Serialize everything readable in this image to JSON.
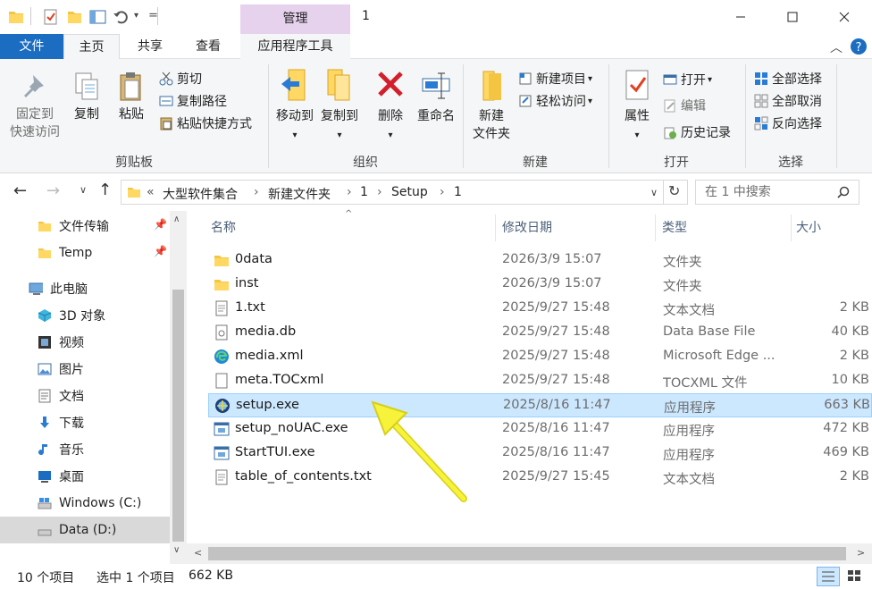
{
  "window": {
    "title": "1",
    "context_tab": "管理"
  },
  "tabs": {
    "file": "文件",
    "home": "主页",
    "share": "共享",
    "view": "查看",
    "app_tools": "应用程序工具"
  },
  "ribbon": {
    "clipboard": {
      "pin": "固定到\n快速访问",
      "pin_l1": "固定到",
      "pin_l2": "快速访问",
      "copy": "复制",
      "paste": "粘贴",
      "cut": "剪切",
      "copy_path": "复制路径",
      "paste_shortcut": "粘贴快捷方式",
      "label": "剪贴板"
    },
    "organize": {
      "move_to": "移动到",
      "copy_to": "复制到",
      "delete": "删除",
      "rename": "重命名",
      "label": "组织"
    },
    "new": {
      "new_folder_l1": "新建",
      "new_folder_l2": "文件夹",
      "new_item": "新建项目",
      "easy_access": "轻松访问",
      "label": "新建"
    },
    "open": {
      "properties": "属性",
      "open": "打开",
      "edit": "编辑",
      "history": "历史记录",
      "label": "打开"
    },
    "select": {
      "select_all": "全部选择",
      "select_none": "全部取消",
      "invert": "反向选择",
      "label": "选择"
    }
  },
  "address": {
    "prefix": "«",
    "crumbs": [
      "大型软件集合",
      "新建文件夹",
      "1",
      "Setup",
      "1"
    ],
    "search_placeholder": "在 1 中搜索"
  },
  "nav": {
    "items": [
      {
        "label": "文件传输",
        "icon": "folder-icon",
        "pinned": true
      },
      {
        "label": "Temp",
        "icon": "folder-icon",
        "pinned": true
      },
      {
        "label": "此电脑",
        "icon": "computer-icon"
      },
      {
        "label": "3D 对象",
        "icon": "cube-icon"
      },
      {
        "label": "视频",
        "icon": "video-icon"
      },
      {
        "label": "图片",
        "icon": "picture-icon"
      },
      {
        "label": "文档",
        "icon": "document-icon"
      },
      {
        "label": "下载",
        "icon": "download-icon"
      },
      {
        "label": "音乐",
        "icon": "music-icon"
      },
      {
        "label": "桌面",
        "icon": "desktop-icon"
      },
      {
        "label": "Windows (C:)",
        "icon": "drive-icon"
      },
      {
        "label": "Data (D:)",
        "icon": "drive-icon",
        "selected": true
      }
    ]
  },
  "columns": {
    "name": "名称",
    "date": "修改日期",
    "type": "类型",
    "size": "大小"
  },
  "files": [
    {
      "name": "0data",
      "date": "2026/3/9 15:07",
      "type": "文件夹",
      "size": "",
      "icon": "folder-icon"
    },
    {
      "name": "inst",
      "date": "2026/3/9 15:07",
      "type": "文件夹",
      "size": "",
      "icon": "folder-icon"
    },
    {
      "name": "1.txt",
      "date": "2025/9/27 15:48",
      "type": "文本文档",
      "size": "2 KB",
      "icon": "text-file-icon"
    },
    {
      "name": "media.db",
      "date": "2025/9/27 15:48",
      "type": "Data Base File",
      "size": "40 KB",
      "icon": "db-file-icon"
    },
    {
      "name": "media.xml",
      "date": "2025/9/27 15:48",
      "type": "Microsoft Edge ...",
      "size": "2 KB",
      "icon": "edge-icon"
    },
    {
      "name": "meta.TOCxml",
      "date": "2025/9/27 15:48",
      "type": "TOCXML 文件",
      "size": "10 KB",
      "icon": "blank-file-icon"
    },
    {
      "name": "setup.exe",
      "date": "2025/8/16 11:47",
      "type": "应用程序",
      "size": "663 KB",
      "icon": "setup-app-icon",
      "selected": true
    },
    {
      "name": "setup_noUAC.exe",
      "date": "2025/8/16 11:47",
      "type": "应用程序",
      "size": "472 KB",
      "icon": "exe-icon"
    },
    {
      "name": "StartTUI.exe",
      "date": "2025/8/16 11:47",
      "type": "应用程序",
      "size": "469 KB",
      "icon": "exe-icon"
    },
    {
      "name": "table_of_contents.txt",
      "date": "2025/9/27 15:45",
      "type": "文本文档",
      "size": "2 KB",
      "icon": "text-file-icon"
    }
  ],
  "status": {
    "count": "10 个项目",
    "selected": "选中 1 个项目",
    "size": "662 KB"
  },
  "colors": {
    "accent": "#1b6dc1",
    "selection": "#cce8ff",
    "arrow": "#f7f23a"
  }
}
